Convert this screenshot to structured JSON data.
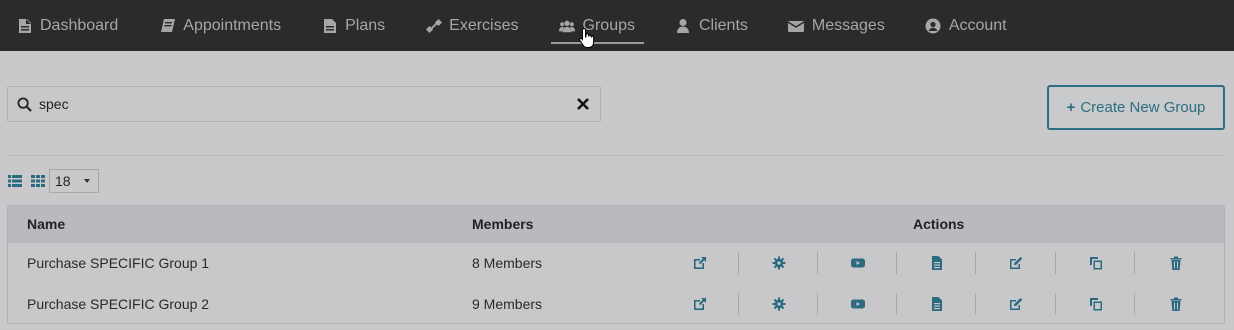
{
  "nav": {
    "items": [
      {
        "label": "Dashboard",
        "icon": "document-icon"
      },
      {
        "label": "Appointments",
        "icon": "book-icon"
      },
      {
        "label": "Plans",
        "icon": "file-icon"
      },
      {
        "label": "Exercises",
        "icon": "dumbbell-icon"
      },
      {
        "label": "Groups",
        "icon": "users-icon",
        "active": true
      },
      {
        "label": "Clients",
        "icon": "user-icon"
      },
      {
        "label": "Messages",
        "icon": "envelope-icon"
      },
      {
        "label": "Account",
        "icon": "user-circle-icon"
      }
    ]
  },
  "search": {
    "value": "spec"
  },
  "create_button": {
    "label": "Create New Group"
  },
  "page_size": "18",
  "table": {
    "headers": {
      "name": "Name",
      "members": "Members",
      "actions": "Actions"
    },
    "rows": [
      {
        "name": "Purchase SPECIFIC Group 1",
        "members": "8 Members"
      },
      {
        "name": "Purchase SPECIFIC Group 2",
        "members": "9 Members"
      }
    ],
    "actions": [
      "external-link-icon",
      "gear-icon",
      "video-icon",
      "document-icon",
      "edit-icon",
      "copy-icon",
      "trash-icon"
    ]
  },
  "colors": {
    "nav_bg": "#2a2b2c",
    "accent": "#2d6f80",
    "page_bg": "#c9c9cb"
  }
}
